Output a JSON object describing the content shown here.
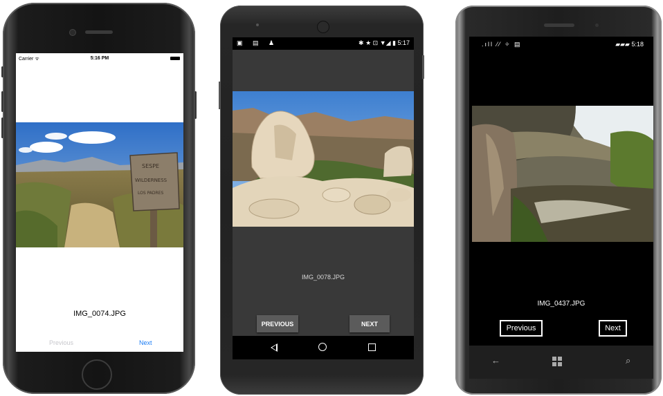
{
  "ios": {
    "status": {
      "carrier": "Carrier ᯤ",
      "time": "5:16 PM"
    },
    "caption": "IMG_0074.JPG",
    "prev_label": "Previous",
    "next_label": "Next",
    "colors": {
      "next": "#1a7cf5",
      "prev_disabled": "#c7c7cc"
    }
  },
  "android": {
    "status": {
      "left_icons": "▣ ▤ ♟",
      "right": "✱ ★ ⊡ ▼◢ ▮ 5:17"
    },
    "caption": "IMG_0078.JPG",
    "prev_label": "PREVIOUS",
    "next_label": "NEXT",
    "nav": [
      "back-icon",
      "home-icon",
      "recents-icon"
    ]
  },
  "windows_phone": {
    "status": {
      "left_icons": ".ıll ⁄⁄ ✧ ▤",
      "right": "▰▰▰ 5:18"
    },
    "caption": "IMG_0437.JPG",
    "prev_label": "Previous",
    "next_label": "Next",
    "nav": {
      "back": "←",
      "search": "⌕"
    }
  }
}
